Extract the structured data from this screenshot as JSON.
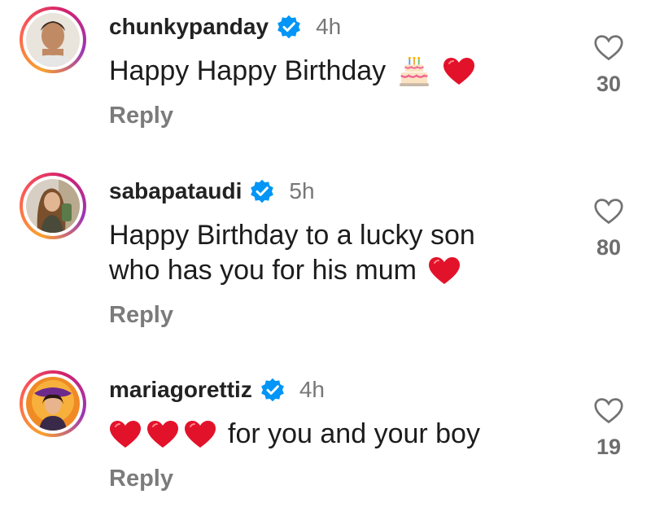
{
  "comments": [
    {
      "username": "chunkypanday",
      "time": "4h",
      "lines": [
        "Happy Happy Birthday"
      ],
      "emojis": [
        "birthday-cake",
        "red-heart"
      ],
      "reply_label": "Reply",
      "likes": "30"
    },
    {
      "username": "sabapataudi",
      "time": "5h",
      "lines": [
        "Happy Birthday to a lucky son",
        "who has you for his mum"
      ],
      "emojis": [
        "red-heart"
      ],
      "reply_label": "Reply",
      "likes": "80"
    },
    {
      "username": "mariagorettiz",
      "time": "4h",
      "lines": [
        "for you and your boy"
      ],
      "emojis": [
        "red-heart",
        "red-heart",
        "red-heart"
      ],
      "reply_label": "Reply",
      "likes": "19"
    }
  ],
  "colors": {
    "verified": "#0095f6",
    "heart": "#e3122b",
    "secondary_text": "#7b7b7b"
  }
}
